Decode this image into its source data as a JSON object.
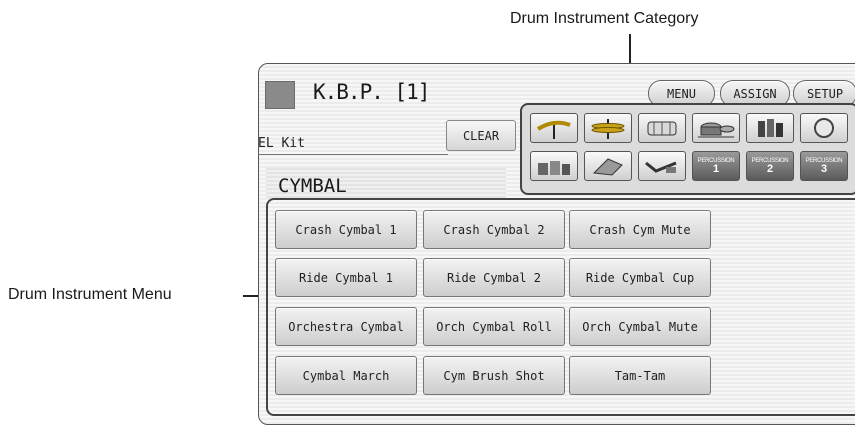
{
  "callouts": {
    "category": "Drum Instrument Category",
    "menu": "Drum Instrument Menu"
  },
  "header": {
    "title": "K.B.P. [1]",
    "menu_label": "MENU",
    "assign_label": "ASSIGN",
    "setup_label": "SETUP"
  },
  "kit": {
    "name": "EL Kit",
    "clear_label": "CLEAR"
  },
  "category": {
    "title": "CYMBAL",
    "icons": [
      "cymbal-icon",
      "hihat-icon",
      "snare-drum-icon",
      "tom-drum-icon",
      "latin-percussion-icon",
      "gong-icon",
      "ethnic-drum-icon",
      "horn-icon",
      "whistle-icon"
    ],
    "percussion": [
      {
        "small": "PERCUSSION",
        "num": "1"
      },
      {
        "small": "PERCUSSION",
        "num": "2"
      },
      {
        "small": "PERCUSSION",
        "num": "3"
      }
    ]
  },
  "instruments": [
    [
      "Crash Cymbal 1",
      "Crash Cymbal 2",
      "Crash Cym Mute"
    ],
    [
      "Ride Cymbal 1",
      "Ride Cymbal 2",
      "Ride Cymbal Cup"
    ],
    [
      "Orchestra Cymbal",
      "Orch Cymbal Roll",
      "Orch Cymbal Mute"
    ],
    [
      "Cymbal March",
      "Cym Brush Shot",
      "Tam-Tam"
    ]
  ],
  "colors": {
    "panel_bg": "#f2f2f2",
    "button_face": "#dedede",
    "border_dark": "#444444",
    "title_square": "#8a8a8a"
  }
}
